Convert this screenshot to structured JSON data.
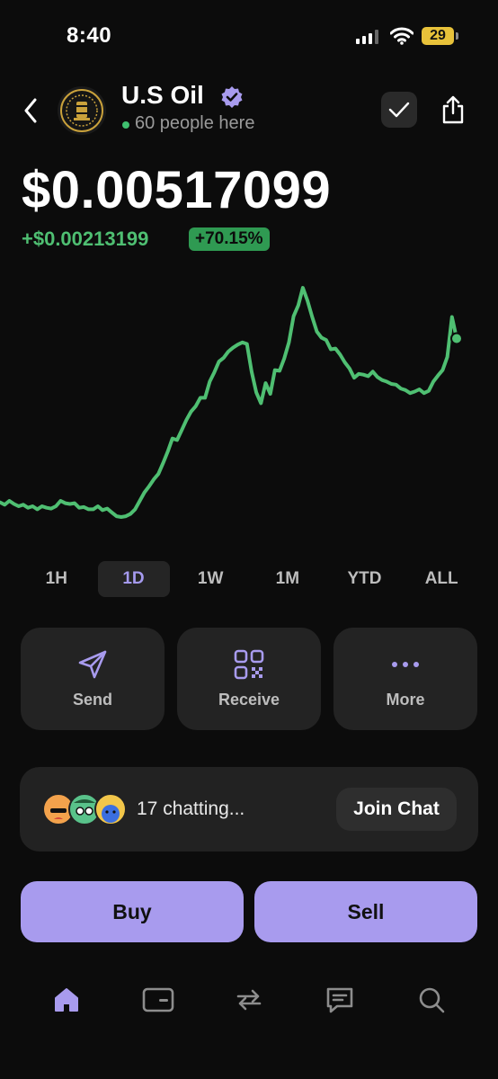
{
  "status_bar": {
    "time": "8:40",
    "battery": "29"
  },
  "header": {
    "token_name": "U.S Oil",
    "people_here": "60 people here"
  },
  "price": {
    "value": "$0.00517099",
    "change": "+$0.00213199",
    "change_pct": "+70.15%"
  },
  "colors": {
    "accent": "#a89bee",
    "positive": "#4fbf72",
    "background": "#0c0c0c"
  },
  "chart_data": {
    "type": "line",
    "title": "",
    "xlabel": "",
    "ylabel": "",
    "series": [
      {
        "values": [
          0.00305,
          0.00302,
          0.00307,
          0.00303,
          0.003,
          0.00302,
          0.00298,
          0.003,
          0.00296,
          0.003,
          0.00298,
          0.00297,
          0.003,
          0.00307,
          0.00304,
          0.00303,
          0.00304,
          0.00298,
          0.00299,
          0.00296,
          0.00296,
          0.003,
          0.00295,
          0.00297,
          0.00292,
          0.00287,
          0.00286,
          0.00287,
          0.0029,
          0.00296,
          0.00307,
          0.00318,
          0.00326,
          0.00335,
          0.00342,
          0.00356,
          0.00371,
          0.00388,
          0.00386,
          0.00399,
          0.00412,
          0.00423,
          0.0043,
          0.00441,
          0.00441,
          0.00462,
          0.00474,
          0.00488,
          0.00493,
          0.00501,
          0.00506,
          0.0051,
          0.00513,
          0.00511,
          0.00475,
          0.00448,
          0.00434,
          0.0046,
          0.00446,
          0.00477,
          0.00476,
          0.00492,
          0.00513,
          0.00547,
          0.00561,
          0.00584,
          0.00567,
          0.00546,
          0.00527,
          0.00519,
          0.00516,
          0.00504,
          0.00505,
          0.00497,
          0.00487,
          0.00479,
          0.00467,
          0.00472,
          0.00471,
          0.00469,
          0.00475,
          0.00468,
          0.00464,
          0.00462,
          0.00459,
          0.00458,
          0.00453,
          0.00451,
          0.00447,
          0.00449,
          0.00452,
          0.00447,
          0.0045,
          0.00462,
          0.0047,
          0.00477,
          0.00494,
          0.00546,
          0.00518
        ]
      }
    ]
  },
  "range_tabs": [
    "1H",
    "1D",
    "1W",
    "1M",
    "YTD",
    "ALL"
  ],
  "active_range": "1D",
  "actions": {
    "send": "Send",
    "receive": "Receive",
    "more": "More"
  },
  "chat": {
    "status": "17 chatting...",
    "join_label": "Join Chat"
  },
  "trade": {
    "buy": "Buy",
    "sell": "Sell"
  },
  "nav": [
    "home-icon",
    "wallet-icon",
    "swap-icon",
    "chat-icon",
    "search-icon"
  ]
}
